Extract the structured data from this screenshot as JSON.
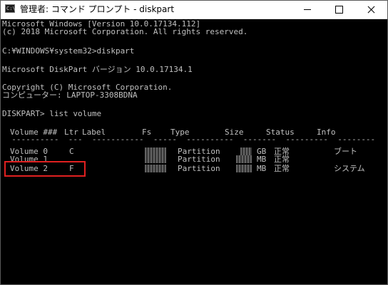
{
  "window": {
    "title": "管理者: コマンド プロンプト - diskpart",
    "icon_name": "console-app-icon",
    "icon_glyph": "C:\\"
  },
  "console_lines": [
    "Microsoft Windows [Version 10.0.17134.112]",
    "(c) 2018 Microsoft Corporation. All rights reserved.",
    "C:¥WINDOWS¥system32>diskpart",
    "Microsoft DiskPart バージョン 10.0.17134.1",
    "Copyright (C) Microsoft Corporation.",
    "コンピューター: LAPTOP-3308BDNA",
    "DISKPART> list volume"
  ],
  "table": {
    "headers": [
      "Volume ###",
      "Ltr",
      "Label",
      "Fs",
      "Type",
      "Size",
      "Status",
      "Info"
    ],
    "separator": "  ----------  ---  -----------  -----  ----------  -------  ---------  --------",
    "rows": [
      {
        "volume": "Volume 0",
        "ltr": "C",
        "type": "Partition",
        "unit": "GB",
        "status": "正常",
        "info": "ブート"
      },
      {
        "volume": "Volume 1",
        "ltr": "",
        "type": "Partition",
        "unit": "MB",
        "status": "正常",
        "info": ""
      },
      {
        "volume": "Volume 2",
        "ltr": "F",
        "type": "Partition",
        "unit": "MB",
        "status": "正常",
        "info": "システム"
      }
    ]
  },
  "colors": {
    "console_bg": "#000000",
    "console_text": "#c0c0c0",
    "highlight": "#e02020"
  }
}
